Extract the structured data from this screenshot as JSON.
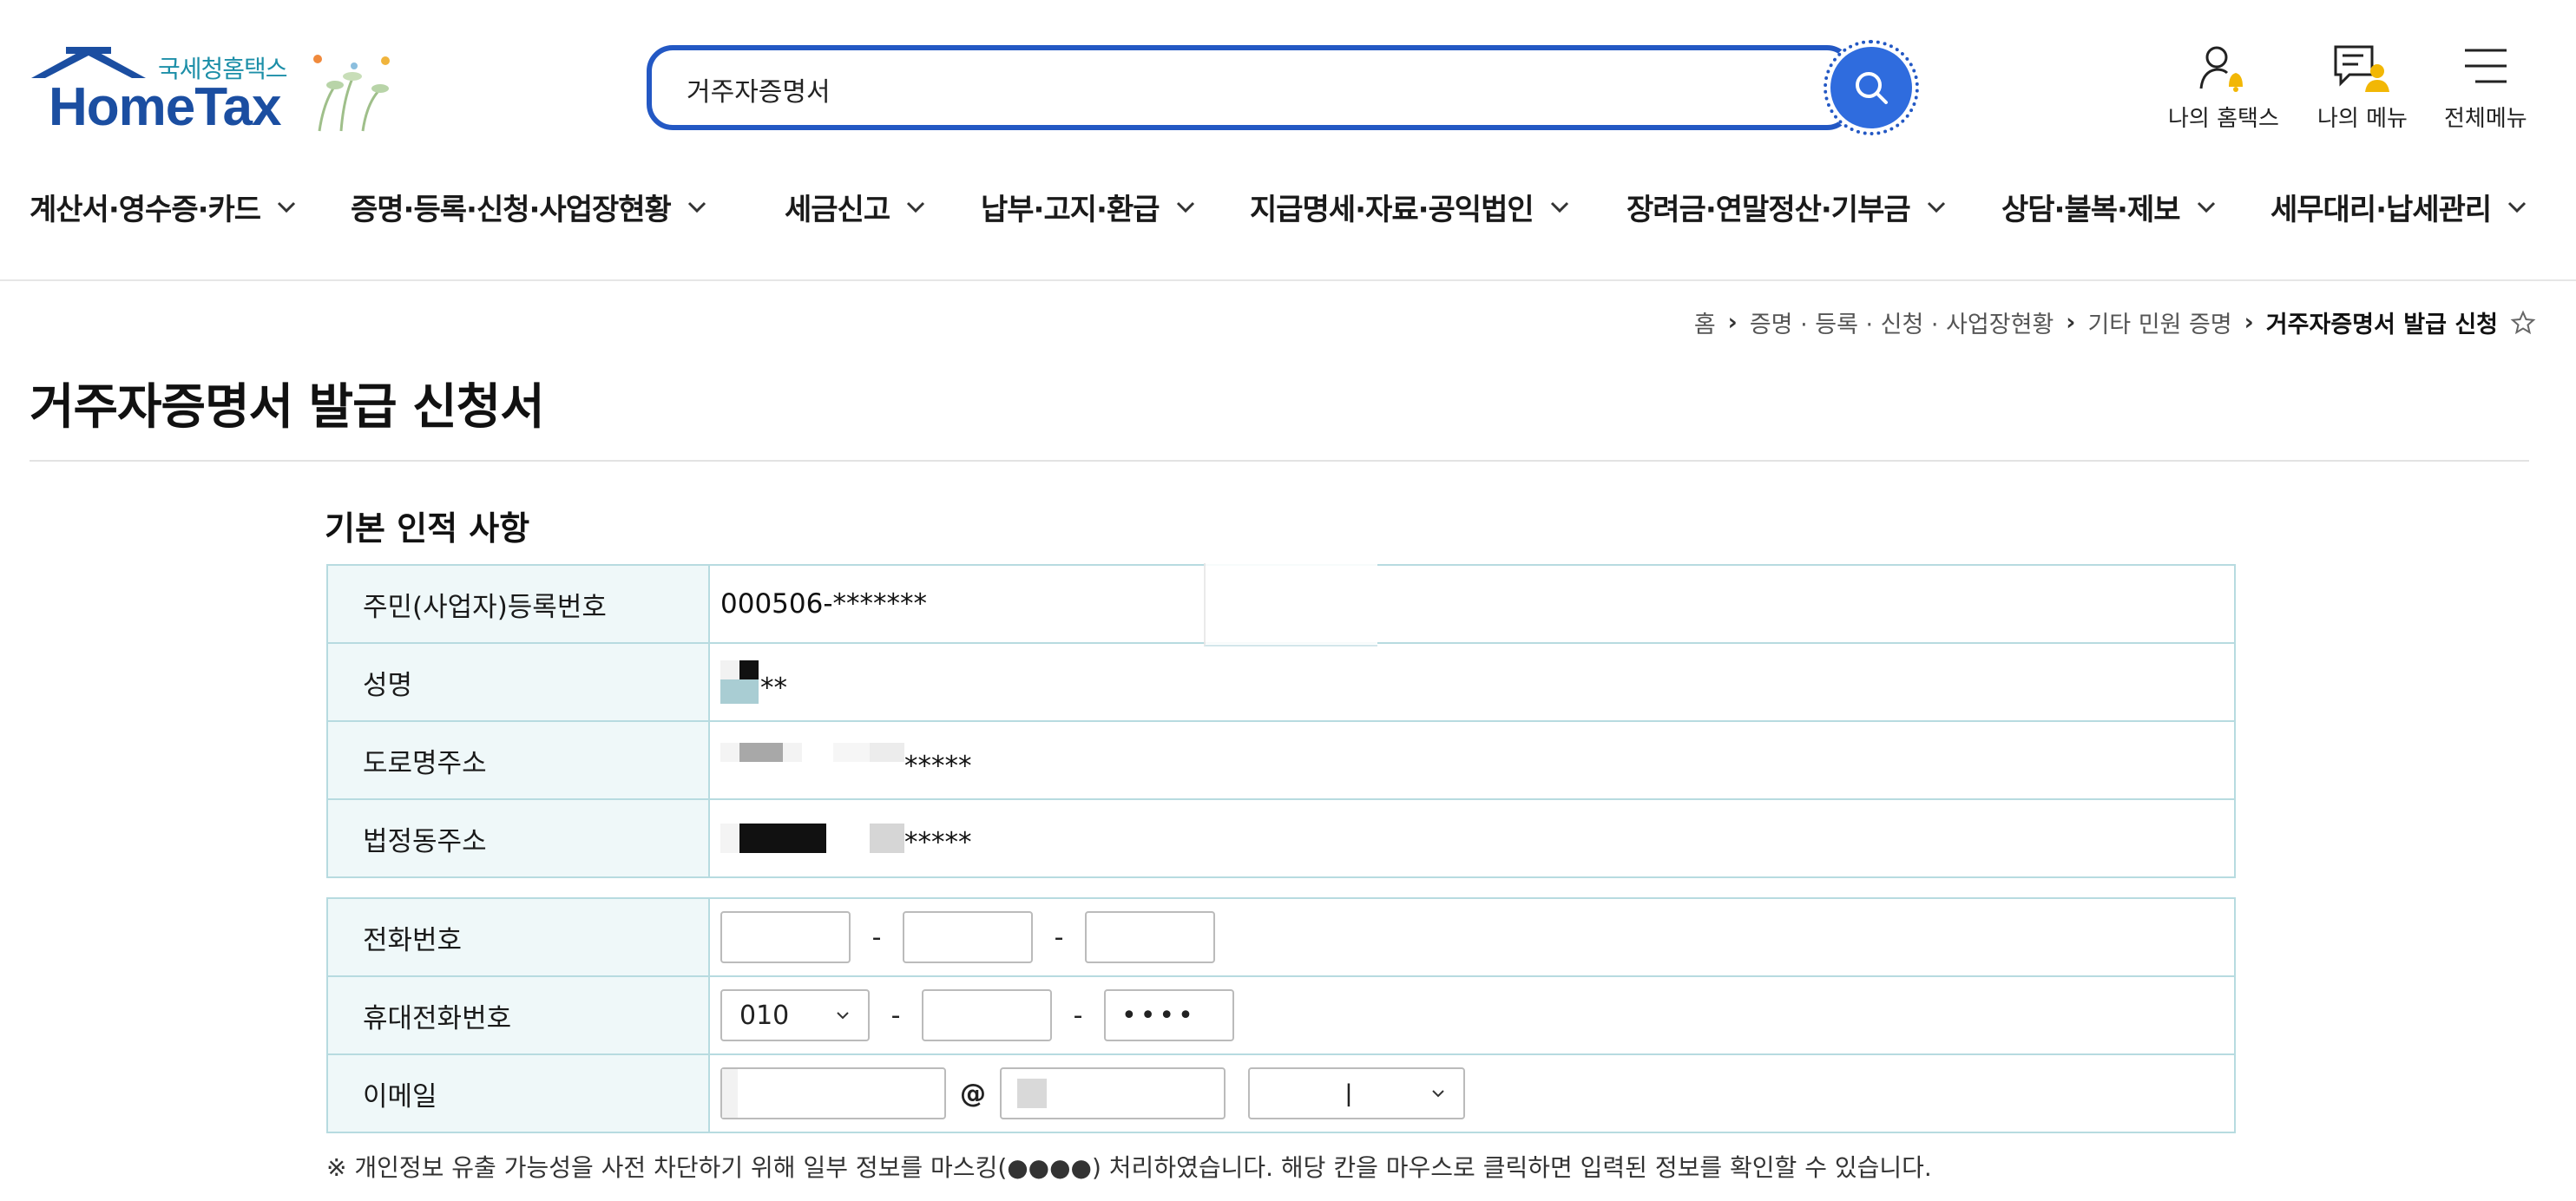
{
  "header": {
    "brand_ko": "국세청홈택스",
    "brand_en": "HomeTax",
    "search_value": "거주자증명서",
    "util": [
      {
        "label": "나의 홈택스",
        "icon": "my-hometax-icon"
      },
      {
        "label": "나의 메뉴",
        "icon": "my-menu-icon"
      },
      {
        "label": "전체메뉴",
        "icon": "hamburger-menu-icon"
      }
    ]
  },
  "gnb": [
    "계산서·영수증·카드",
    "증명·등록·신청·사업장현황",
    "세금신고",
    "납부·고지·환급",
    "지급명세·자료·공익법인",
    "장려금·연말정산·기부금",
    "상담·불복·제보",
    "세무대리·납세관리"
  ],
  "breadcrumb": [
    "홈",
    "증명 · 등록 · 신청 · 사업장현황",
    "기타 민원 증명",
    "거주자증명서 발급 신청"
  ],
  "page_title": "거주자증명서 발급 신청서",
  "section_title": "기본 인적 사항",
  "basic_info": {
    "rrn_label": "주민(사업자)등록번호",
    "rrn_value": "000506-*******",
    "name_label": "성명",
    "name_value": "**",
    "road_address_label": "도로명주소",
    "road_address_value": "*****",
    "lot_address_label": "법정동주소",
    "lot_address_value": "*****"
  },
  "contact": {
    "phone_label": "전화번호",
    "mobile_label": "휴대전화번호",
    "mobile_prefix": "010",
    "mobile_last": "••••",
    "email_label": "이메일",
    "email_at": "@",
    "email_domain_select": "ㅣ",
    "dash": "-"
  },
  "notice": "※ 개인정보 유출 가능성을 사전 차단하기 위해 일부 정보를 마스킹(●●●●) 처리하였습니다. 해당 칸을 마우스로 클릭하면 입력된 정보를 확인할 수 있습니다.",
  "colors": {
    "brand_blue": "#1b4ea1",
    "search_border": "#2358c4",
    "search_button": "#2f6cde",
    "table_border": "#b7dbe0",
    "table_header_bg": "#eff8f9"
  }
}
